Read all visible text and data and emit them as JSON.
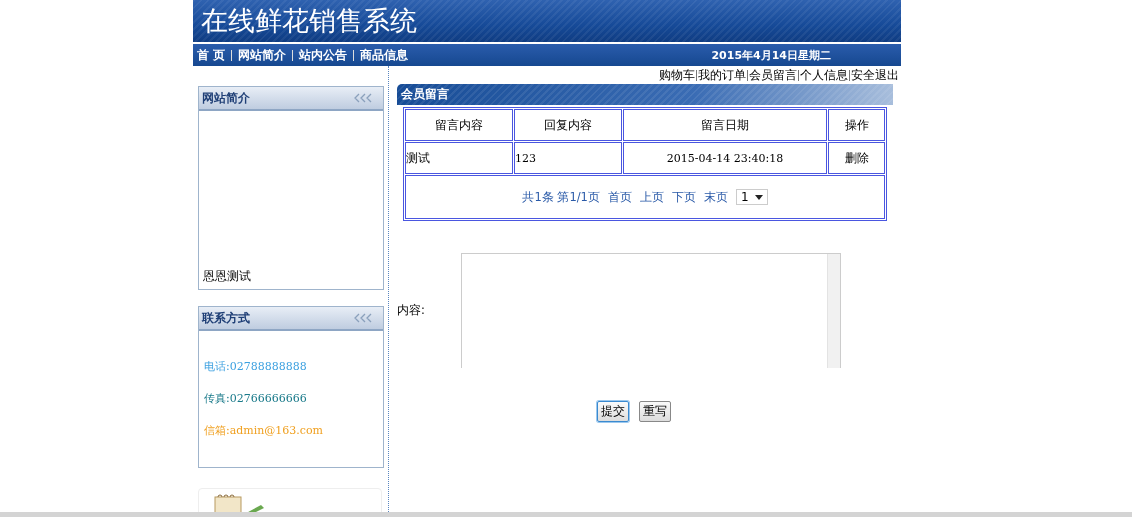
{
  "site_title": "在线鲜花销售系统",
  "nav": [
    {
      "label": "首 页"
    },
    {
      "label": "网站简介"
    },
    {
      "label": "站内公告"
    },
    {
      "label": "商品信息"
    }
  ],
  "date": "2015年4月14日星期二",
  "user_links": [
    {
      "label": "购物车"
    },
    {
      "label": "我的订单"
    },
    {
      "label": "会员留言"
    },
    {
      "label": "个人信息"
    },
    {
      "label": "安全退出"
    }
  ],
  "intro_panel": {
    "title": "网站简介",
    "text": "恩恩测试"
  },
  "contact_panel": {
    "title": "联系方式",
    "items": [
      {
        "text": "电话:02788888888",
        "color": "#3ba0e0"
      },
      {
        "text": "传真:02766666666",
        "color": "#1a7a8a"
      },
      {
        "text": "信箱:admin@163.com",
        "color": "#f0a020"
      }
    ]
  },
  "messages": {
    "title": "会员留言",
    "columns": [
      "留言内容",
      "回复内容",
      "留言日期",
      "操作"
    ],
    "rows": [
      {
        "content": "测试",
        "reply": "123",
        "date": "2015-04-14 23:40:18",
        "action": "删除"
      }
    ],
    "pager": {
      "summary": "共1条 第1/1页",
      "links": [
        "首页",
        "上页",
        "下页",
        "末页"
      ],
      "page": "1"
    }
  },
  "form": {
    "label": "内容:",
    "buttons": [
      {
        "label": "提交",
        "focused": true
      },
      {
        "label": "重写",
        "focused": false
      }
    ]
  }
}
